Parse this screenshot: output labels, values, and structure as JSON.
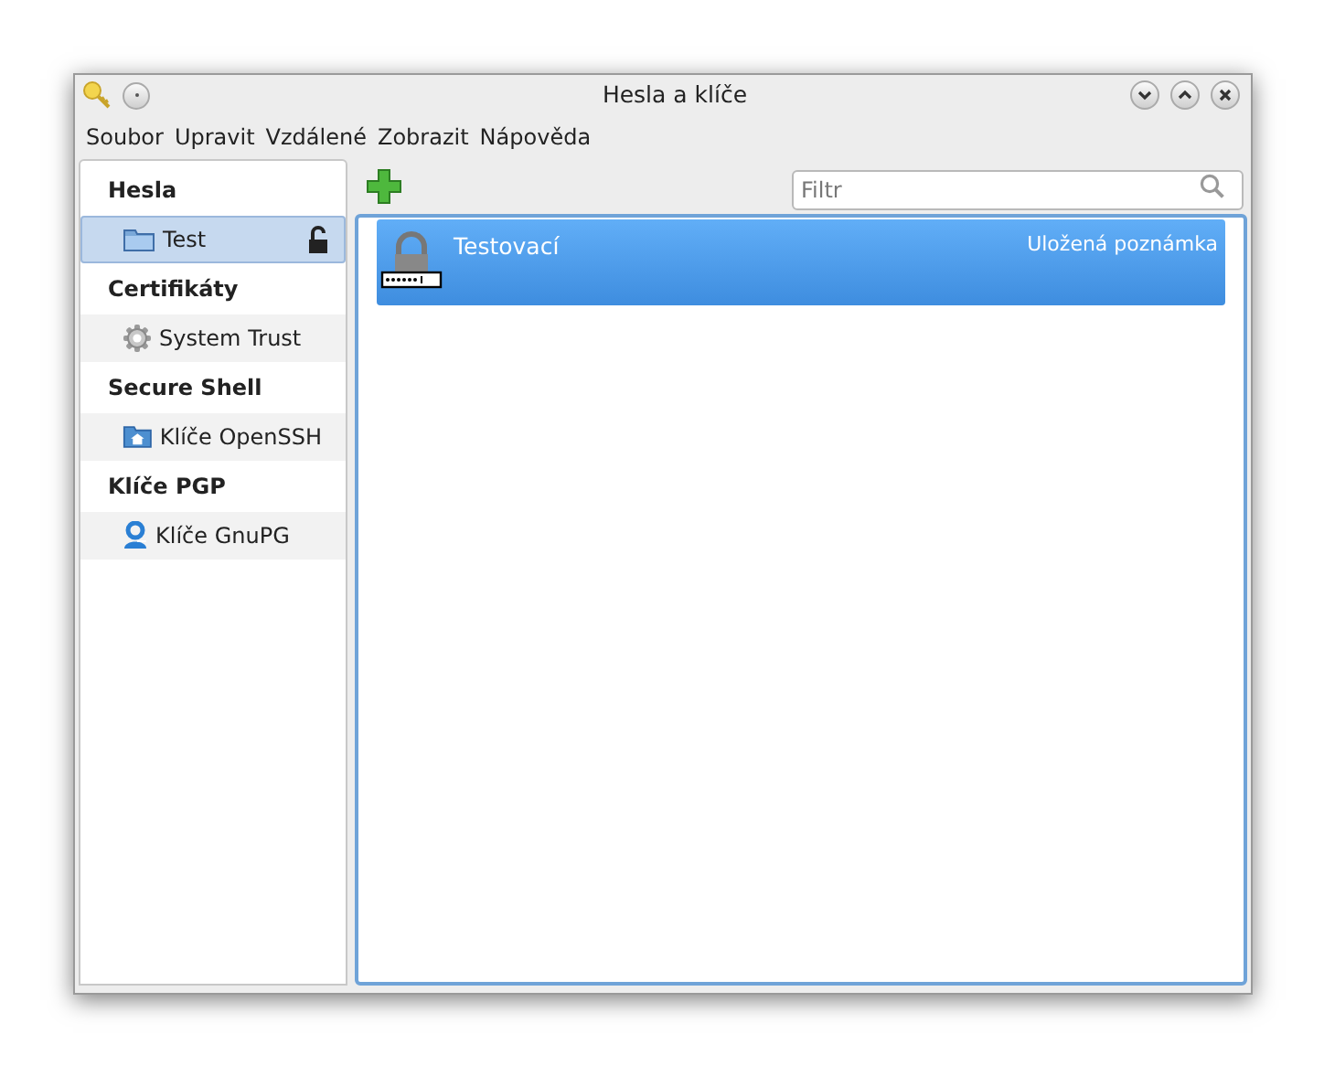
{
  "window": {
    "title": "Hesla a klíče"
  },
  "menu": [
    "Soubor",
    "Upravit",
    "Vzdálené",
    "Zobrazit",
    "Nápověda"
  ],
  "sidebar": {
    "groups": [
      {
        "title": "Hesla",
        "items": [
          {
            "label": "Test",
            "kind": "folder",
            "selected": true,
            "locked": false
          }
        ]
      },
      {
        "title": "Certifikáty",
        "items": [
          {
            "label": "System Trust",
            "kind": "gear",
            "selected": false
          }
        ]
      },
      {
        "title": "Secure Shell",
        "items": [
          {
            "label": "Klíče OpenSSH",
            "kind": "home",
            "selected": false
          }
        ]
      },
      {
        "title": "Klíče PGP",
        "items": [
          {
            "label": "Klíče GnuPG",
            "kind": "person",
            "selected": false
          }
        ]
      }
    ]
  },
  "search": {
    "placeholder": "Filtr"
  },
  "items": [
    {
      "name": "Testovací",
      "type": "Uložená poznámka",
      "selected": true
    }
  ]
}
